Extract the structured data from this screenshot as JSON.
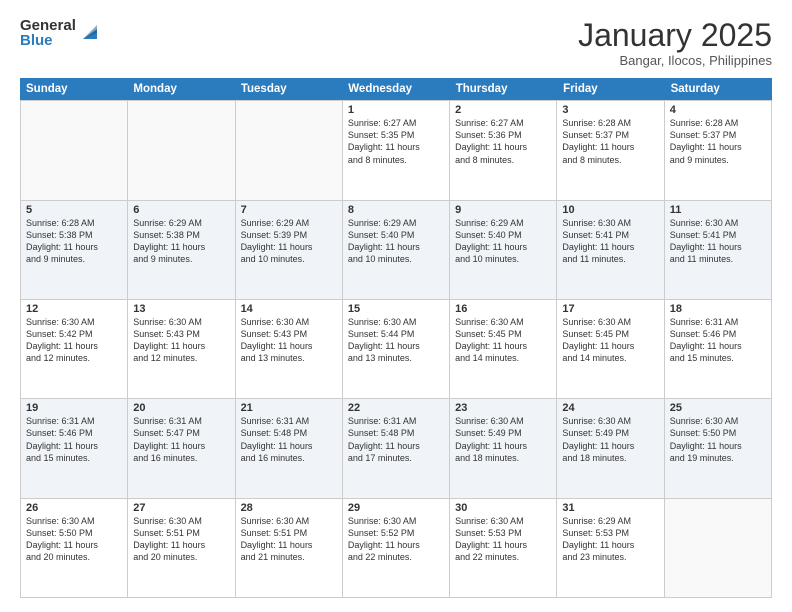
{
  "logo": {
    "general": "General",
    "blue": "Blue"
  },
  "title": "January 2025",
  "location": "Bangar, Ilocos, Philippines",
  "days": [
    "Sunday",
    "Monday",
    "Tuesday",
    "Wednesday",
    "Thursday",
    "Friday",
    "Saturday"
  ],
  "rows": [
    [
      {
        "day": "",
        "text": ""
      },
      {
        "day": "",
        "text": ""
      },
      {
        "day": "",
        "text": ""
      },
      {
        "day": "1",
        "text": "Sunrise: 6:27 AM\nSunset: 5:35 PM\nDaylight: 11 hours\nand 8 minutes."
      },
      {
        "day": "2",
        "text": "Sunrise: 6:27 AM\nSunset: 5:36 PM\nDaylight: 11 hours\nand 8 minutes."
      },
      {
        "day": "3",
        "text": "Sunrise: 6:28 AM\nSunset: 5:37 PM\nDaylight: 11 hours\nand 8 minutes."
      },
      {
        "day": "4",
        "text": "Sunrise: 6:28 AM\nSunset: 5:37 PM\nDaylight: 11 hours\nand 9 minutes."
      }
    ],
    [
      {
        "day": "5",
        "text": "Sunrise: 6:28 AM\nSunset: 5:38 PM\nDaylight: 11 hours\nand 9 minutes."
      },
      {
        "day": "6",
        "text": "Sunrise: 6:29 AM\nSunset: 5:38 PM\nDaylight: 11 hours\nand 9 minutes."
      },
      {
        "day": "7",
        "text": "Sunrise: 6:29 AM\nSunset: 5:39 PM\nDaylight: 11 hours\nand 10 minutes."
      },
      {
        "day": "8",
        "text": "Sunrise: 6:29 AM\nSunset: 5:40 PM\nDaylight: 11 hours\nand 10 minutes."
      },
      {
        "day": "9",
        "text": "Sunrise: 6:29 AM\nSunset: 5:40 PM\nDaylight: 11 hours\nand 10 minutes."
      },
      {
        "day": "10",
        "text": "Sunrise: 6:30 AM\nSunset: 5:41 PM\nDaylight: 11 hours\nand 11 minutes."
      },
      {
        "day": "11",
        "text": "Sunrise: 6:30 AM\nSunset: 5:41 PM\nDaylight: 11 hours\nand 11 minutes."
      }
    ],
    [
      {
        "day": "12",
        "text": "Sunrise: 6:30 AM\nSunset: 5:42 PM\nDaylight: 11 hours\nand 12 minutes."
      },
      {
        "day": "13",
        "text": "Sunrise: 6:30 AM\nSunset: 5:43 PM\nDaylight: 11 hours\nand 12 minutes."
      },
      {
        "day": "14",
        "text": "Sunrise: 6:30 AM\nSunset: 5:43 PM\nDaylight: 11 hours\nand 13 minutes."
      },
      {
        "day": "15",
        "text": "Sunrise: 6:30 AM\nSunset: 5:44 PM\nDaylight: 11 hours\nand 13 minutes."
      },
      {
        "day": "16",
        "text": "Sunrise: 6:30 AM\nSunset: 5:45 PM\nDaylight: 11 hours\nand 14 minutes."
      },
      {
        "day": "17",
        "text": "Sunrise: 6:30 AM\nSunset: 5:45 PM\nDaylight: 11 hours\nand 14 minutes."
      },
      {
        "day": "18",
        "text": "Sunrise: 6:31 AM\nSunset: 5:46 PM\nDaylight: 11 hours\nand 15 minutes."
      }
    ],
    [
      {
        "day": "19",
        "text": "Sunrise: 6:31 AM\nSunset: 5:46 PM\nDaylight: 11 hours\nand 15 minutes."
      },
      {
        "day": "20",
        "text": "Sunrise: 6:31 AM\nSunset: 5:47 PM\nDaylight: 11 hours\nand 16 minutes."
      },
      {
        "day": "21",
        "text": "Sunrise: 6:31 AM\nSunset: 5:48 PM\nDaylight: 11 hours\nand 16 minutes."
      },
      {
        "day": "22",
        "text": "Sunrise: 6:31 AM\nSunset: 5:48 PM\nDaylight: 11 hours\nand 17 minutes."
      },
      {
        "day": "23",
        "text": "Sunrise: 6:30 AM\nSunset: 5:49 PM\nDaylight: 11 hours\nand 18 minutes."
      },
      {
        "day": "24",
        "text": "Sunrise: 6:30 AM\nSunset: 5:49 PM\nDaylight: 11 hours\nand 18 minutes."
      },
      {
        "day": "25",
        "text": "Sunrise: 6:30 AM\nSunset: 5:50 PM\nDaylight: 11 hours\nand 19 minutes."
      }
    ],
    [
      {
        "day": "26",
        "text": "Sunrise: 6:30 AM\nSunset: 5:50 PM\nDaylight: 11 hours\nand 20 minutes."
      },
      {
        "day": "27",
        "text": "Sunrise: 6:30 AM\nSunset: 5:51 PM\nDaylight: 11 hours\nand 20 minutes."
      },
      {
        "day": "28",
        "text": "Sunrise: 6:30 AM\nSunset: 5:51 PM\nDaylight: 11 hours\nand 21 minutes."
      },
      {
        "day": "29",
        "text": "Sunrise: 6:30 AM\nSunset: 5:52 PM\nDaylight: 11 hours\nand 22 minutes."
      },
      {
        "day": "30",
        "text": "Sunrise: 6:30 AM\nSunset: 5:53 PM\nDaylight: 11 hours\nand 22 minutes."
      },
      {
        "day": "31",
        "text": "Sunrise: 6:29 AM\nSunset: 5:53 PM\nDaylight: 11 hours\nand 23 minutes."
      },
      {
        "day": "",
        "text": ""
      }
    ]
  ],
  "alt_rows": [
    1,
    3
  ]
}
